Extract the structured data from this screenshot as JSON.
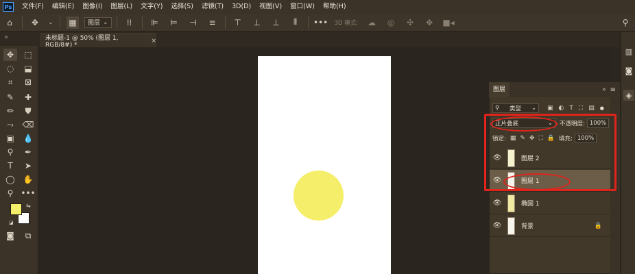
{
  "menubar": {
    "logo": "Ps",
    "items": [
      "文件(F)",
      "编辑(E)",
      "图像(I)",
      "图层(L)",
      "文字(Y)",
      "选择(S)",
      "滤镜(T)",
      "3D(D)",
      "视图(V)",
      "窗口(W)",
      "帮助(H)"
    ]
  },
  "options": {
    "auto_select_target": "图层",
    "mode_3d_label": "3D 模式:"
  },
  "document": {
    "tab_title": "未标题-1 @ 50% (图层 1, RGB/8#) *",
    "close_glyph": "×"
  },
  "layers_panel": {
    "title": "图层",
    "filter_kind": "类型",
    "blend_mode": "正片叠底",
    "opacity_label": "不透明度:",
    "opacity_value": "100%",
    "lock_label": "锁定:",
    "fill_label": "填充:",
    "fill_value": "100%",
    "layers": [
      {
        "name": "图层 2",
        "selected": false,
        "locked": false
      },
      {
        "name": "图层 1",
        "selected": true,
        "locked": false
      },
      {
        "name": "椭圆 1",
        "selected": false,
        "locked": false
      },
      {
        "name": "背景",
        "selected": false,
        "locked": true
      }
    ]
  },
  "colors": {
    "foreground": "#f5ee6a",
    "background": "#ffffff",
    "annotation": "#e0241b"
  }
}
